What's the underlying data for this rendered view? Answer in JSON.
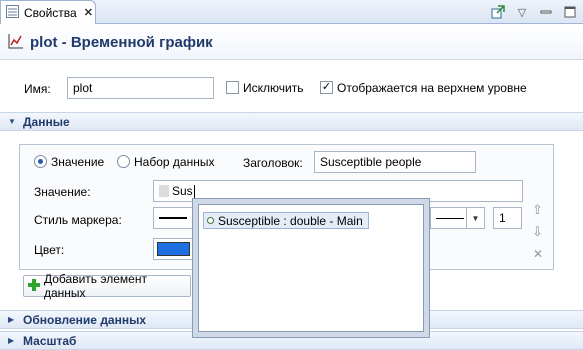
{
  "tab": {
    "label": "Свойства",
    "close": "✕"
  },
  "header": {
    "title": "plot - Временной график"
  },
  "name_row": {
    "label": "Имя:",
    "value": "plot",
    "exclude_label": "Исключить",
    "exclude_checked": false,
    "top_level_label": "Отображается на верхнем уровне",
    "top_level_checked": true
  },
  "sections": {
    "data": "Данные",
    "update": "Обновление данных",
    "scale": "Масштаб"
  },
  "data_group": {
    "radio_value": "Значение",
    "radio_dataset": "Набор данных",
    "title_label": "Заголовок:",
    "title_value": "Susceptible people",
    "value_label": "Значение:",
    "value_text": "Sus",
    "marker_label": "Стиль маркера:",
    "marker_size": "1",
    "color_label": "Цвет:"
  },
  "add_button": "Добавить элемент данных",
  "autocomplete": {
    "items": [
      "Susceptible : double - Main"
    ]
  },
  "colors": {
    "accent": "#1f3a6b",
    "color_swatch": "#1e6fe0"
  }
}
